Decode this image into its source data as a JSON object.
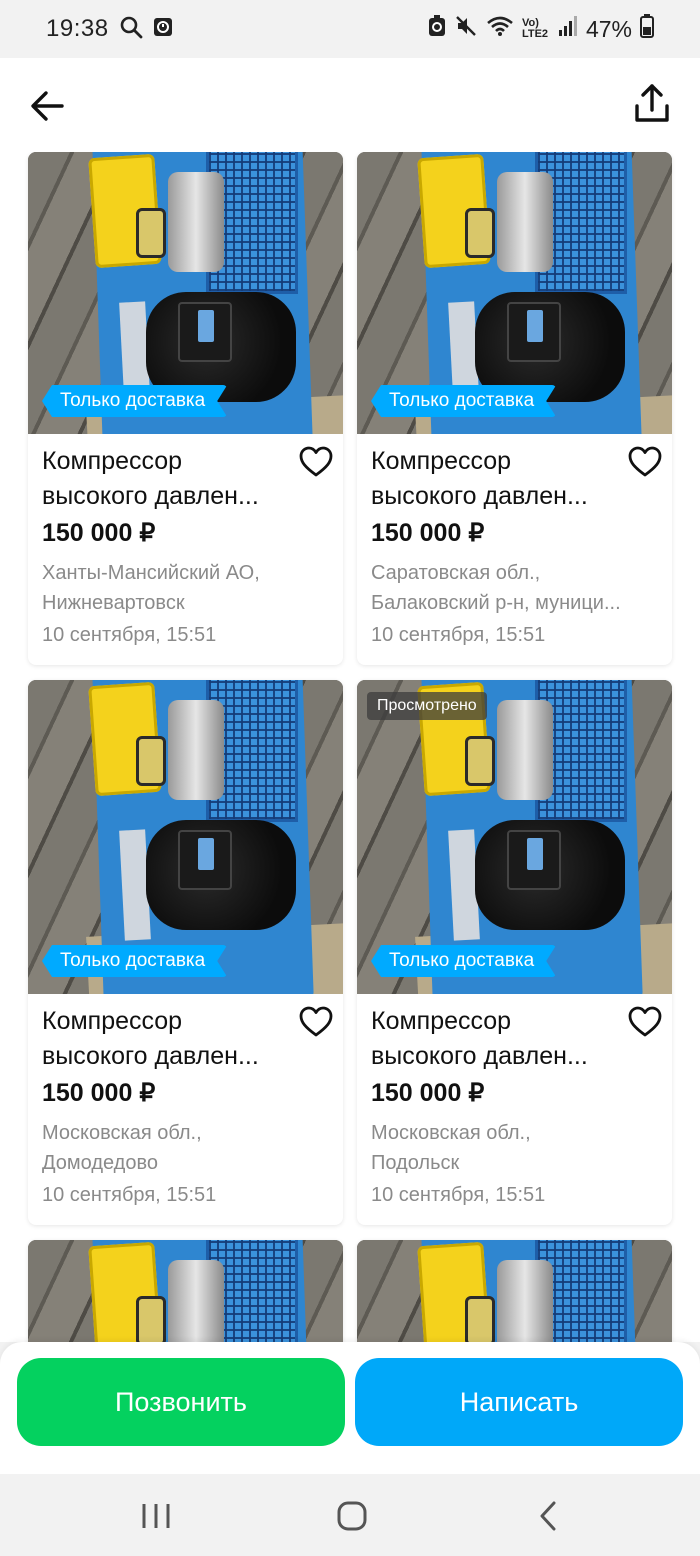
{
  "status_bar": {
    "time": "19:38",
    "battery": "47%",
    "network": "Vo) LTE2",
    "icons": [
      "search-icon",
      "alarm-icon",
      "battery-saver-icon",
      "mute-icon",
      "wifi-icon",
      "signal-icon",
      "battery-icon"
    ]
  },
  "header": {
    "back_icon": "arrow-left-icon",
    "share_icon": "share-upload-icon"
  },
  "listings": [
    {
      "title": "Компрессор высокого давлен...",
      "price": "150 000 ₽",
      "location_line1": "Ханты-Мансийский АО,",
      "location_line2": "Нижневартовск",
      "date": "10 сентября, 15:51",
      "badge": "Только доставка",
      "viewed": ""
    },
    {
      "title": "Компрессор высокого давлен...",
      "price": "150 000 ₽",
      "location_line1": "Саратовская обл.,",
      "location_line2": "Балаковский р-н, муници...",
      "date": "10 сентября, 15:51",
      "badge": "Только доставка",
      "viewed": ""
    },
    {
      "title": "Компрессор высокого давлен...",
      "price": "150 000 ₽",
      "location_line1": "Московская обл.,",
      "location_line2": "Домодедово",
      "date": "10 сентября, 15:51",
      "badge": "Только доставка",
      "viewed": ""
    },
    {
      "title": "Компрессор высокого давлен...",
      "price": "150 000 ₽",
      "location_line1": "Московская обл.,",
      "location_line2": "Подольск",
      "date": "10 сентября, 15:51",
      "badge": "Только доставка",
      "viewed": "Просмотрено"
    }
  ],
  "actions": {
    "call_label": "Позвонить",
    "write_label": "Написать",
    "call_color": "#04d15f",
    "write_color": "#00a8f9"
  },
  "colors": {
    "badge": "#00aaff",
    "muted_text": "#8a8a8a"
  }
}
